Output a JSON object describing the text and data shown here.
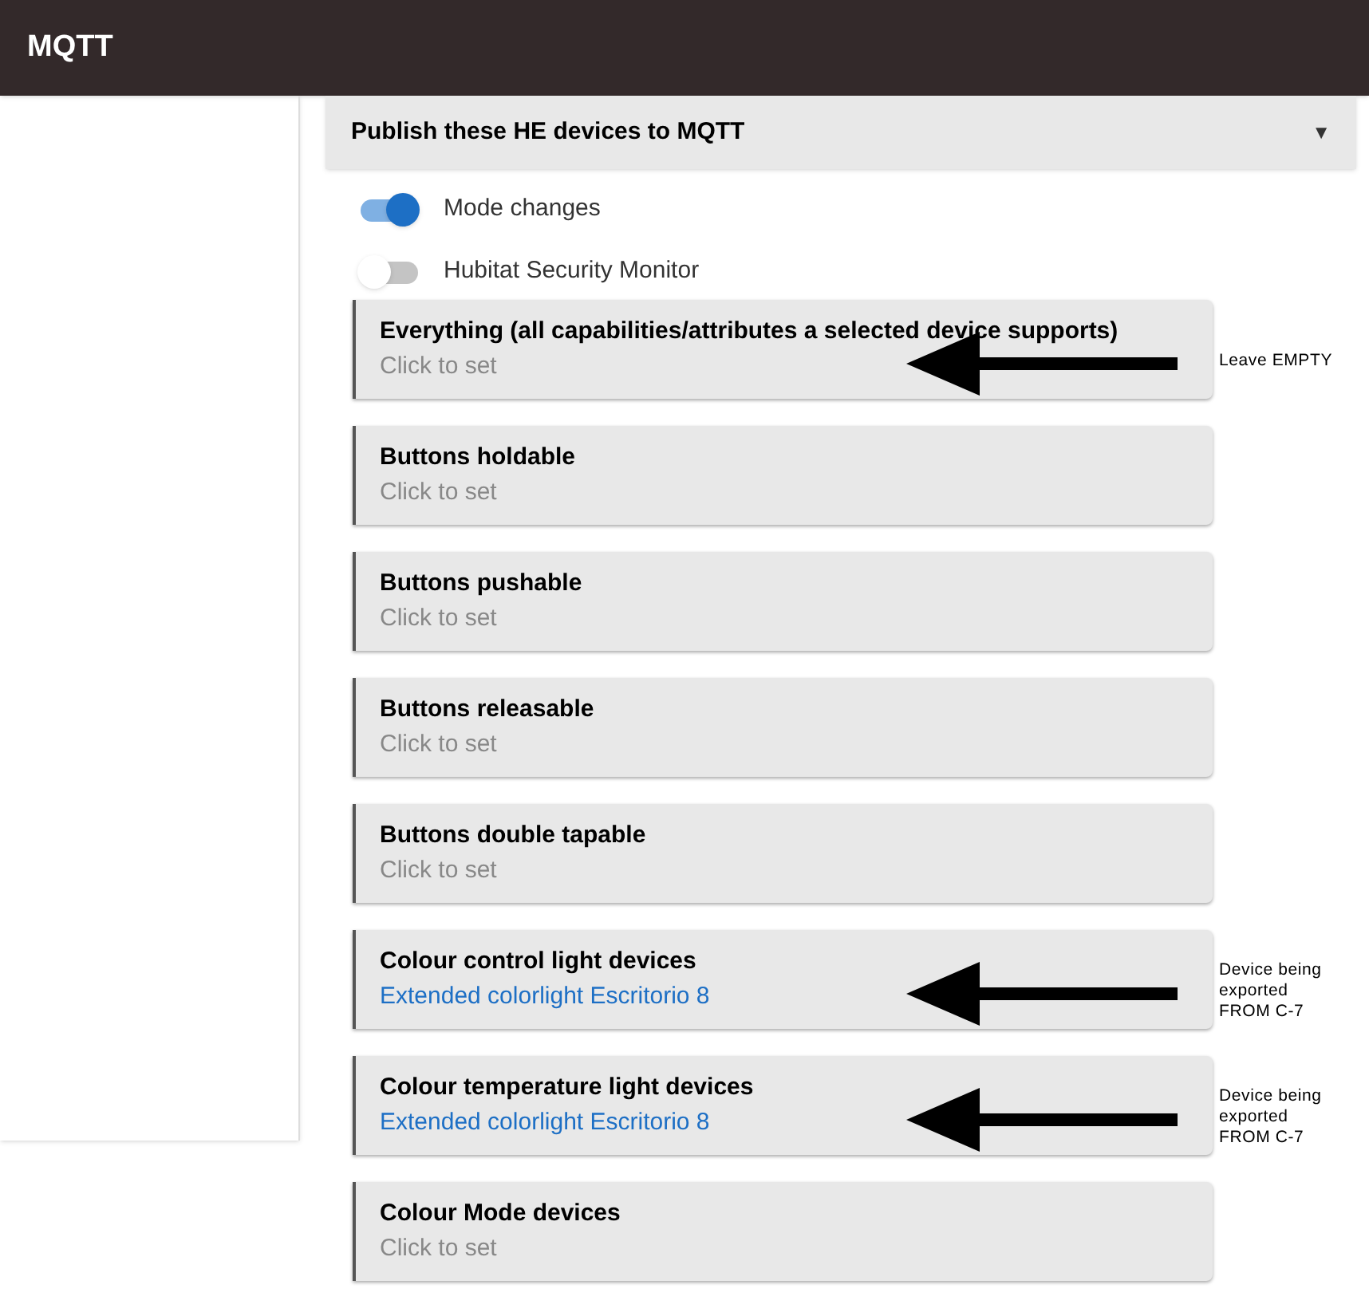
{
  "app_bar": {
    "title": "MQTT"
  },
  "section": {
    "title": "Publish these HE devices to MQTT",
    "expanded": true,
    "indicator": "▼"
  },
  "toggles": [
    {
      "label": "Mode changes",
      "on": true
    },
    {
      "label": "Hubitat Security Monitor",
      "on": false
    }
  ],
  "cards": [
    {
      "title": "Everything (all capabilities/attributes a selected device supports)",
      "subtitle": "Click to set",
      "set": false,
      "annotation": "Leave EMPTY"
    },
    {
      "title": "Buttons holdable",
      "subtitle": "Click to set",
      "set": false
    },
    {
      "title": "Buttons pushable",
      "subtitle": "Click to set",
      "set": false
    },
    {
      "title": "Buttons releasable",
      "subtitle": "Click to set",
      "set": false
    },
    {
      "title": "Buttons double tapable",
      "subtitle": "Click to set",
      "set": false
    },
    {
      "title": "Colour control light devices",
      "subtitle": "Extended colorlight Escritorio 8",
      "set": true,
      "annotation": "Device being exported FROM C-7"
    },
    {
      "title": "Colour temperature light devices",
      "subtitle": "Extended colorlight Escritorio 8",
      "set": true,
      "annotation": "Device being exported FROM C-7"
    },
    {
      "title": "Colour Mode devices",
      "subtitle": "Click to set",
      "set": false
    }
  ]
}
